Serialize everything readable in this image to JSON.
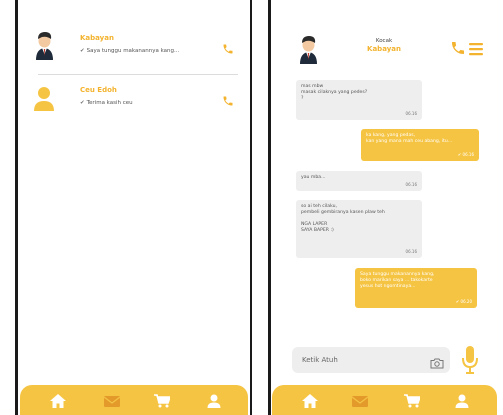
{
  "colors": {
    "accent": "#F5C443",
    "accent_text": "#F3B32E",
    "bubble_in": "#eeeeee"
  },
  "chat_list": {
    "items": [
      {
        "name": "Kabayan",
        "preview": "Saya tunggu makanannya kang...",
        "avatar": "man-avatar-icon",
        "status": "read"
      },
      {
        "name": "Ceu Edoh",
        "preview": "Terima kasih ceu",
        "avatar": "user-silhouette-icon",
        "status": "read"
      }
    ]
  },
  "conversation": {
    "header": {
      "top_label": "Kocak",
      "name": "Kabayan"
    },
    "messages": [
      {
        "direction": "in",
        "lines": [
          "mas mbw",
          "masak cilaknya yang pedes?",
          "?"
        ],
        "time": "06.16"
      },
      {
        "direction": "out",
        "lines": [
          "ka kang, yang pedas,",
          "kan yang mana mah ceu abang, itu..."
        ],
        "time": "06.16"
      },
      {
        "direction": "in",
        "lines": [
          "yau mba..."
        ],
        "time": "06.16"
      },
      {
        "direction": "in",
        "lines": [
          "so ai teh cilaku,",
          "pembeli gembiranya kasen plaw teh",
          "",
          "NGA LAPER",
          "SAYA BAPER :)"
        ],
        "time": "06.16"
      },
      {
        "direction": "out",
        "lines": [
          "Saya tunggu makanannya kang,",
          "boko marikan saya ... takokarte",
          "yesus hot ngomtinaya..."
        ],
        "time": "06.20"
      }
    ],
    "input_placeholder": "Ketik Atuh"
  },
  "nav": {
    "items": [
      "home-icon",
      "mail-icon",
      "cart-icon",
      "profile-icon"
    ]
  }
}
